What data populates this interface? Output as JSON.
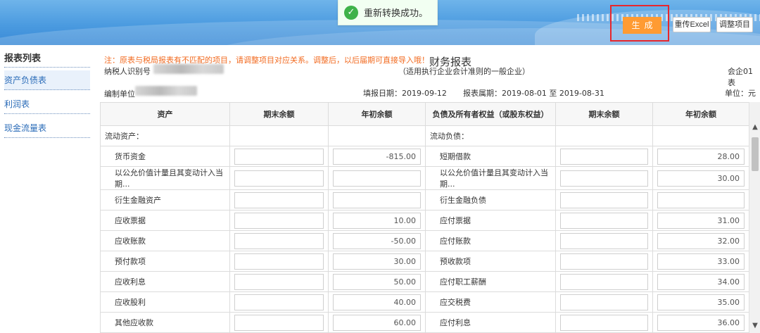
{
  "toast": {
    "icon": "check-circle-icon",
    "message": "重新转换成功。"
  },
  "toolbar": {
    "generate_label": "生成",
    "reupload_label": "重传Excel",
    "adjust_label": "调整项目"
  },
  "sidebar": {
    "title": "报表列表",
    "items": [
      {
        "label": "资产负债表",
        "active": true
      },
      {
        "label": "利润表",
        "active": false
      },
      {
        "label": "现金流量表",
        "active": false
      }
    ]
  },
  "report": {
    "notice": "注：原表与税局报表有不匹配的项目，请调整项目对应关系。调整后，以后届期可直接导入哦！",
    "title": "财务报表",
    "subtitle": "（适用执行企业会计准则的一般企业）",
    "taxpayer_id_label": "纳税人识别号",
    "form_code": "会企01表",
    "company_label": "编制单位",
    "fill_date_label": "填报日期：",
    "fill_date": "2019-09-12",
    "period_label": "报表属期：",
    "period": "2019-08-01 至 2019-08-31",
    "unit": "单位：元"
  },
  "table": {
    "headers": [
      "资产",
      "期末余额",
      "年初余额",
      "负债及所有者权益（或股东权益）",
      "期末余额",
      "年初余额"
    ],
    "rows": [
      {
        "asset": "流动资产：",
        "a_end": null,
        "a_begin": null,
        "liab": "流动负债：",
        "l_end": null,
        "l_begin": null,
        "section": true
      },
      {
        "asset": "货币资金",
        "a_end": "",
        "a_begin": "-815.00",
        "liab": "短期借款",
        "l_end": "",
        "l_begin": "28.00"
      },
      {
        "asset": "以公允价值计量且其变动计入当期...",
        "a_end": "",
        "a_begin": "",
        "liab": "以公允价值计量且其变动计入当期...",
        "l_end": "",
        "l_begin": "30.00"
      },
      {
        "asset": "衍生金融资产",
        "a_end": "",
        "a_begin": "",
        "liab": "衍生金融负债",
        "l_end": "",
        "l_begin": ""
      },
      {
        "asset": "应收票据",
        "a_end": "",
        "a_begin": "10.00",
        "liab": "应付票据",
        "l_end": "",
        "l_begin": "31.00"
      },
      {
        "asset": "应收账款",
        "a_end": "",
        "a_begin": "-50.00",
        "liab": "应付账款",
        "l_end": "",
        "l_begin": "32.00"
      },
      {
        "asset": "预付款项",
        "a_end": "",
        "a_begin": "30.00",
        "liab": "预收款项",
        "l_end": "",
        "l_begin": "33.00"
      },
      {
        "asset": "应收利息",
        "a_end": "",
        "a_begin": "50.00",
        "liab": "应付职工薪酬",
        "l_end": "",
        "l_begin": "34.00"
      },
      {
        "asset": "应收股利",
        "a_end": "",
        "a_begin": "40.00",
        "liab": "应交税费",
        "l_end": "",
        "l_begin": "35.00"
      },
      {
        "asset": "其他应收款",
        "a_end": "",
        "a_begin": "60.00",
        "liab": "应付利息",
        "l_end": "",
        "l_begin": "36.00"
      }
    ]
  }
}
